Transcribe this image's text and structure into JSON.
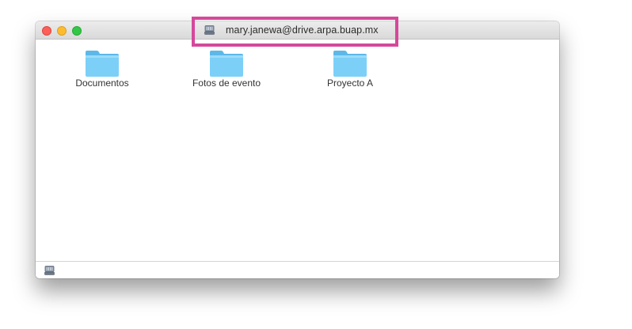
{
  "window": {
    "title": "mary.janewa@drive.arpa.buap.mx"
  },
  "folders": [
    {
      "label": "Documentos",
      "icon": "folder-icon"
    },
    {
      "label": "Fotos de evento",
      "icon": "folder-icon"
    },
    {
      "label": "Proyecto A",
      "icon": "folder-icon"
    }
  ],
  "statusbar": {
    "icon": "network-drive-icon"
  },
  "colors": {
    "folder": "#6cc7f3",
    "highlight": "#d5489b",
    "close": "#fc5f57",
    "minimize": "#fdbc2e",
    "zoom": "#33c748"
  }
}
